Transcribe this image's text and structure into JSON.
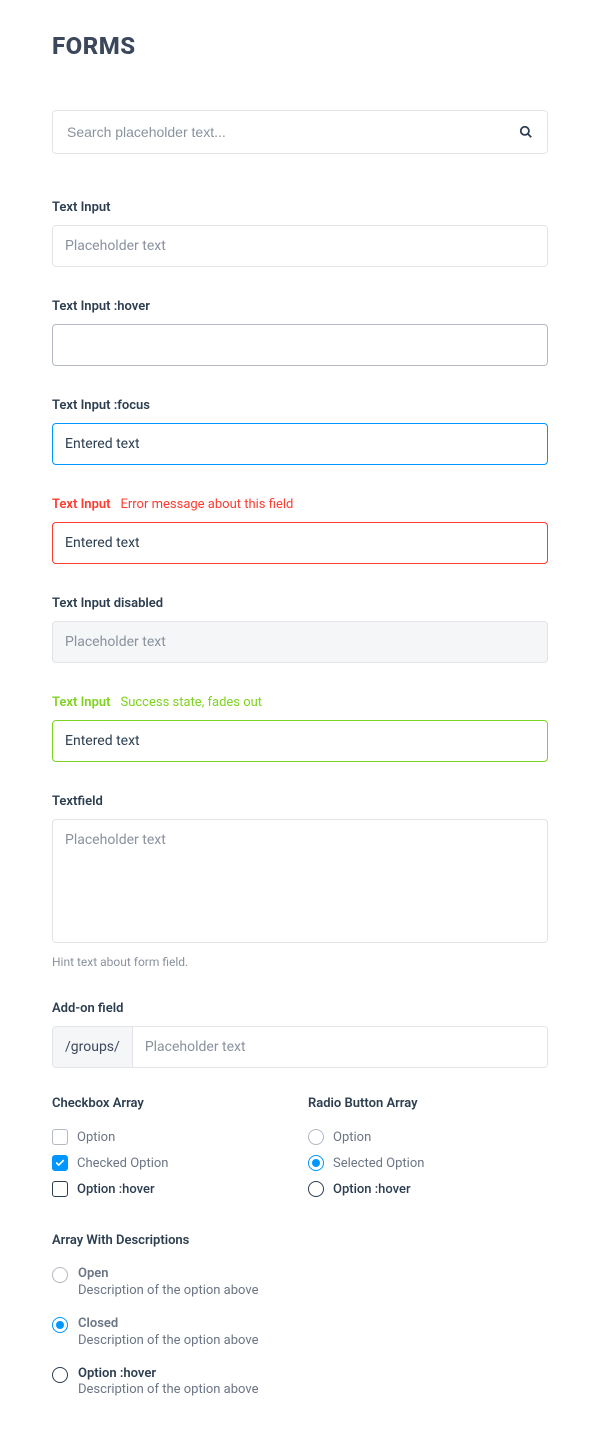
{
  "heading": "FORMS",
  "search": {
    "placeholder": "Search placeholder text..."
  },
  "fields": {
    "text_input": {
      "label": "Text Input",
      "placeholder": "Placeholder text"
    },
    "hover": {
      "label": "Text Input :hover"
    },
    "focus": {
      "label": "Text Input :focus",
      "value": "Entered text"
    },
    "error": {
      "label": "Text Input",
      "msg": "Error message about this field",
      "value": "Entered text"
    },
    "disabled": {
      "label": "Text Input disabled",
      "placeholder": "Placeholder text"
    },
    "success": {
      "label": "Text Input",
      "msg": "Success state, fades out",
      "value": "Entered text"
    },
    "textfield": {
      "label": "Textfield",
      "placeholder": "Placeholder text",
      "hint": "Hint text about form field."
    },
    "addon": {
      "label": "Add-on field",
      "prefix": "/groups/",
      "placeholder": "Placeholder text"
    }
  },
  "checkbox_array": {
    "title": "Checkbox Array",
    "options": [
      {
        "label": "Option",
        "checked": false
      },
      {
        "label": "Checked Option",
        "checked": true
      },
      {
        "label": "Option :hover",
        "checked": false
      }
    ]
  },
  "radio_array": {
    "title": "Radio Button Array",
    "options": [
      {
        "label": "Option",
        "selected": false
      },
      {
        "label": "Selected Option",
        "selected": true
      },
      {
        "label": "Option :hover",
        "selected": false
      }
    ]
  },
  "desc_array": {
    "title": "Array With Descriptions",
    "options": [
      {
        "label": "Open",
        "desc": "Description of the option above",
        "selected": false
      },
      {
        "label": "Closed",
        "desc": "Description of the option above",
        "selected": true
      },
      {
        "label": "Option :hover",
        "desc": "Description of the option above",
        "selected": false
      }
    ]
  }
}
